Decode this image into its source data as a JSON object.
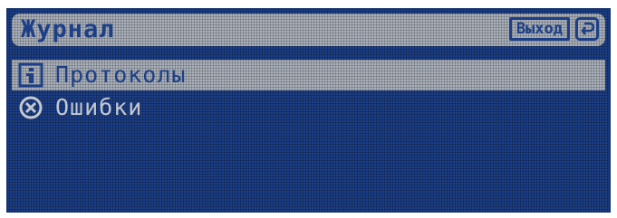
{
  "header": {
    "title": "Журнал",
    "exit_label": "Выход",
    "exit_icon": "return-arrow-icon"
  },
  "menu": {
    "items": [
      {
        "label": "Протоколы",
        "icon": "info-icon",
        "selected": true
      },
      {
        "label": "Ошибки",
        "icon": "error-circle-icon",
        "selected": false
      }
    ]
  },
  "colors": {
    "background": "#1c3f87",
    "highlight": "#a9b0ba",
    "text_on_dark": "#c3c8d0"
  }
}
